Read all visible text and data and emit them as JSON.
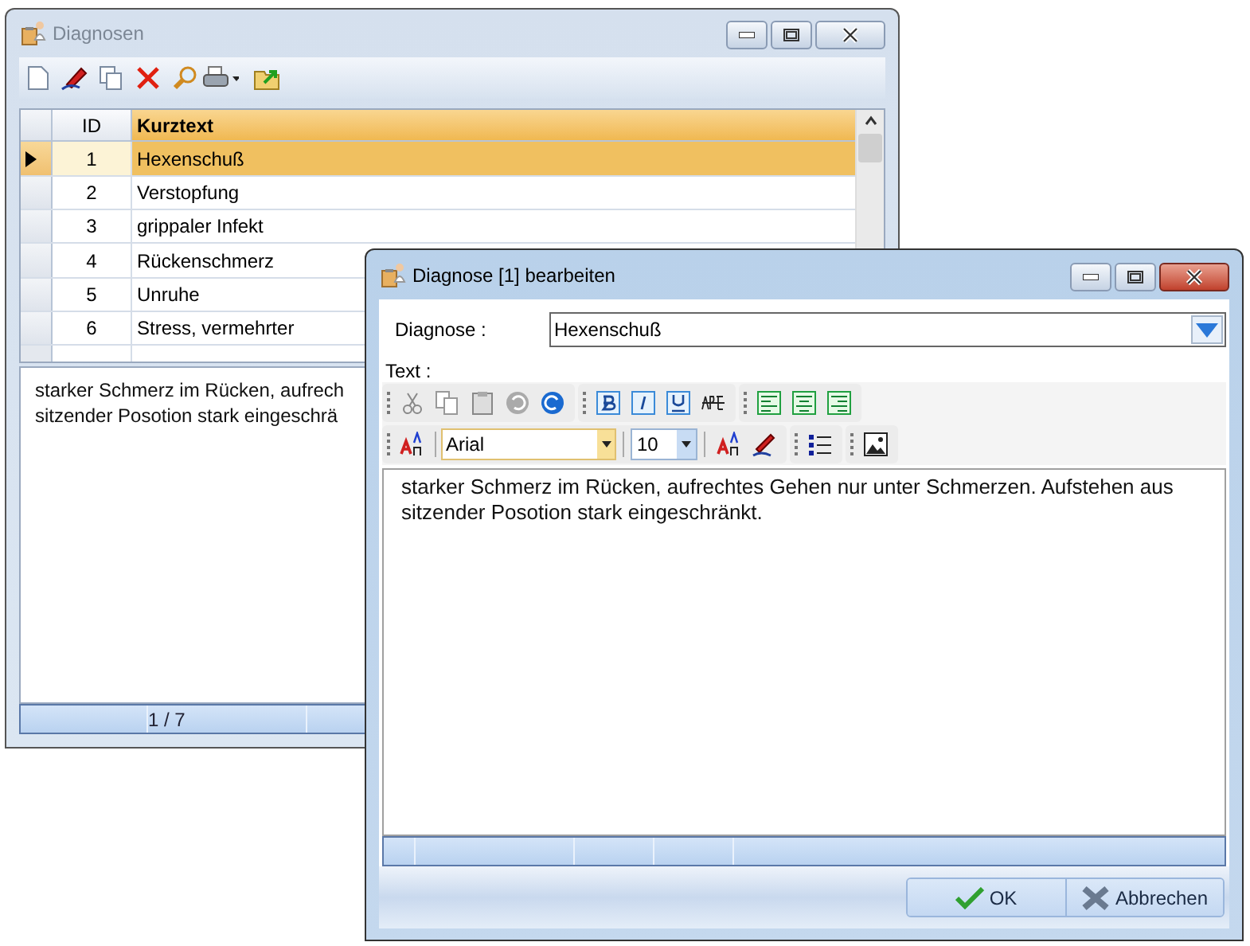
{
  "main_window": {
    "title": "Diagnosen",
    "grid": {
      "columns": [
        "ID",
        "Kurztext"
      ],
      "rows": [
        {
          "id": "1",
          "text": "Hexenschuß",
          "selected": true
        },
        {
          "id": "2",
          "text": "Verstopfung",
          "selected": false
        },
        {
          "id": "3",
          "text": "grippaler Infekt",
          "selected": false
        },
        {
          "id": "4",
          "text": "Rückenschmerz",
          "selected": false
        },
        {
          "id": "5",
          "text": "Unruhe",
          "selected": false
        },
        {
          "id": "6",
          "text": "Stress, vermehrter",
          "selected": false
        }
      ]
    },
    "memo_lines": [
      "starker Schmerz im Rücken, aufrech",
      "sitzender Posotion stark eingeschrä"
    ],
    "status": "1 / 7"
  },
  "dialog": {
    "title": "Diagnose [1] bearbeiten",
    "diagnose_label": "Diagnose :",
    "diagnose_value": "Hexenschuß",
    "text_label": "Text :",
    "font_name": "Arial",
    "font_size": "10",
    "body": "starker Schmerz im Rücken, aufrechtes Gehen nur unter Schmerzen. Aufstehen aus sitzender Posotion stark eingeschränkt.",
    "buttons": [
      {
        "label": "OK",
        "kind": "ok"
      },
      {
        "label": "Abbrechen",
        "kind": "cancel"
      }
    ]
  }
}
